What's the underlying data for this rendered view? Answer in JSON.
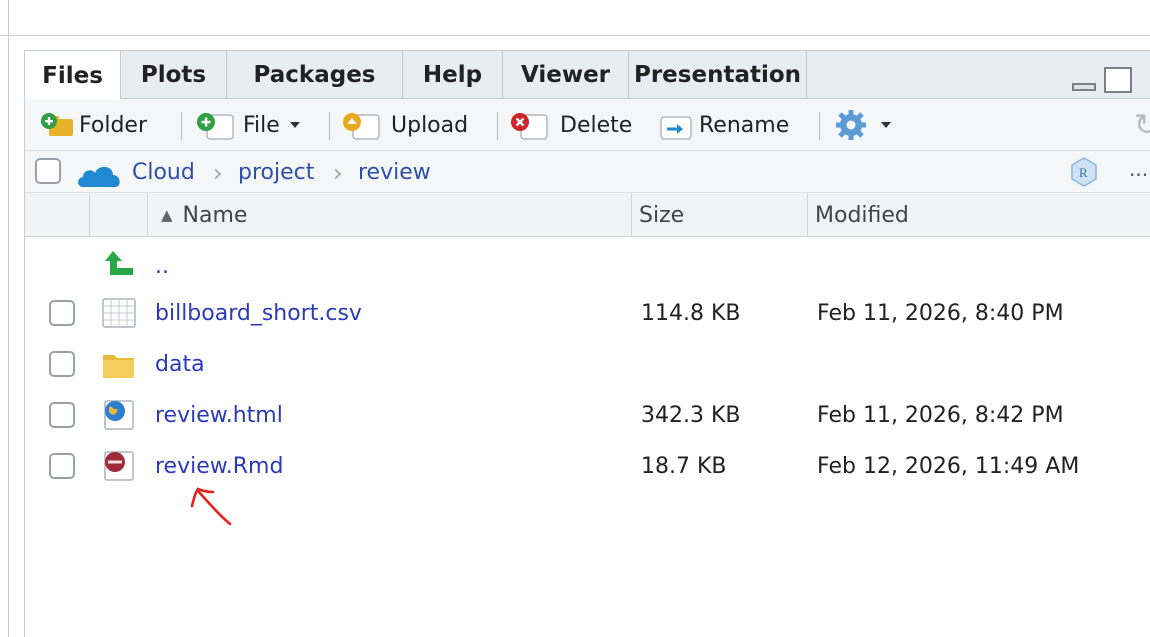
{
  "tabs": [
    {
      "label": "Files",
      "active": true
    },
    {
      "label": "Plots",
      "active": false
    },
    {
      "label": "Packages",
      "active": false
    },
    {
      "label": "Help",
      "active": false
    },
    {
      "label": "Viewer",
      "active": false
    },
    {
      "label": "Presentation",
      "active": false
    }
  ],
  "toolbar": {
    "new_folder": "Folder",
    "new_file": "File",
    "upload": "Upload",
    "delete": "Delete",
    "rename": "Rename",
    "icons": [
      "add-folder-icon",
      "add-file-icon",
      "upload-icon",
      "delete-icon",
      "rename-icon",
      "gear-icon",
      "refresh-icon"
    ]
  },
  "breadcrumb": {
    "root": "Cloud",
    "items": [
      "project",
      "review"
    ],
    "more": "..."
  },
  "columns": {
    "name": "Name",
    "size": "Size",
    "modified": "Modified",
    "sort_indicator": "▲"
  },
  "parent_dir": "..",
  "files": [
    {
      "name": "billboard_short.csv",
      "size": "114.8 KB",
      "modified": "Feb 11, 2026, 8:40 PM",
      "icon": "csv-table-icon"
    },
    {
      "name": "data",
      "size": "",
      "modified": "",
      "icon": "folder-icon"
    },
    {
      "name": "review.html",
      "size": "342.3 KB",
      "modified": "Feb 11, 2026, 8:42 PM",
      "icon": "html-globe-icon"
    },
    {
      "name": "review.Rmd",
      "size": "18.7 KB",
      "modified": "Feb 12, 2026, 11:49 AM",
      "icon": "rmd-file-icon"
    }
  ],
  "colors": {
    "link": "#2a3ab8",
    "tab_bg": "#e9edf1",
    "cloud": "#1f8ad2",
    "annotation": "#e8221b"
  }
}
